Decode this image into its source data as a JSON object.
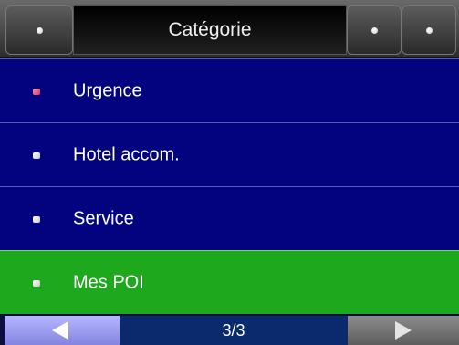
{
  "header": {
    "title": "Catégorie",
    "back_icon": "back-dot-icon",
    "action_icons": [
      "option-a-dot-icon",
      "option-b-dot-icon"
    ]
  },
  "list": {
    "items": [
      {
        "label": "Urgence",
        "icon": "category-bullet-icon",
        "icon_color": "#e0507a",
        "selected": false
      },
      {
        "label": "Hotel accom.",
        "icon": "category-bullet-icon",
        "icon_color": "#ffffff",
        "selected": false
      },
      {
        "label": "Service",
        "icon": "category-bullet-icon",
        "icon_color": "#ffffff",
        "selected": false
      },
      {
        "label": "Mes POI",
        "icon": "category-bullet-icon",
        "icon_color": "#ffffff",
        "selected": true
      }
    ]
  },
  "footer": {
    "page_indicator": "3/3",
    "prev_icon": "arrow-left-icon",
    "next_icon": "arrow-right-icon"
  },
  "colors": {
    "list_bg": "#030380",
    "selected_bg": "#1da81d",
    "prev_button": "#a0a0f0",
    "next_button": "#7a7a7a",
    "page_indicator_bg": "#0b2a6e"
  }
}
